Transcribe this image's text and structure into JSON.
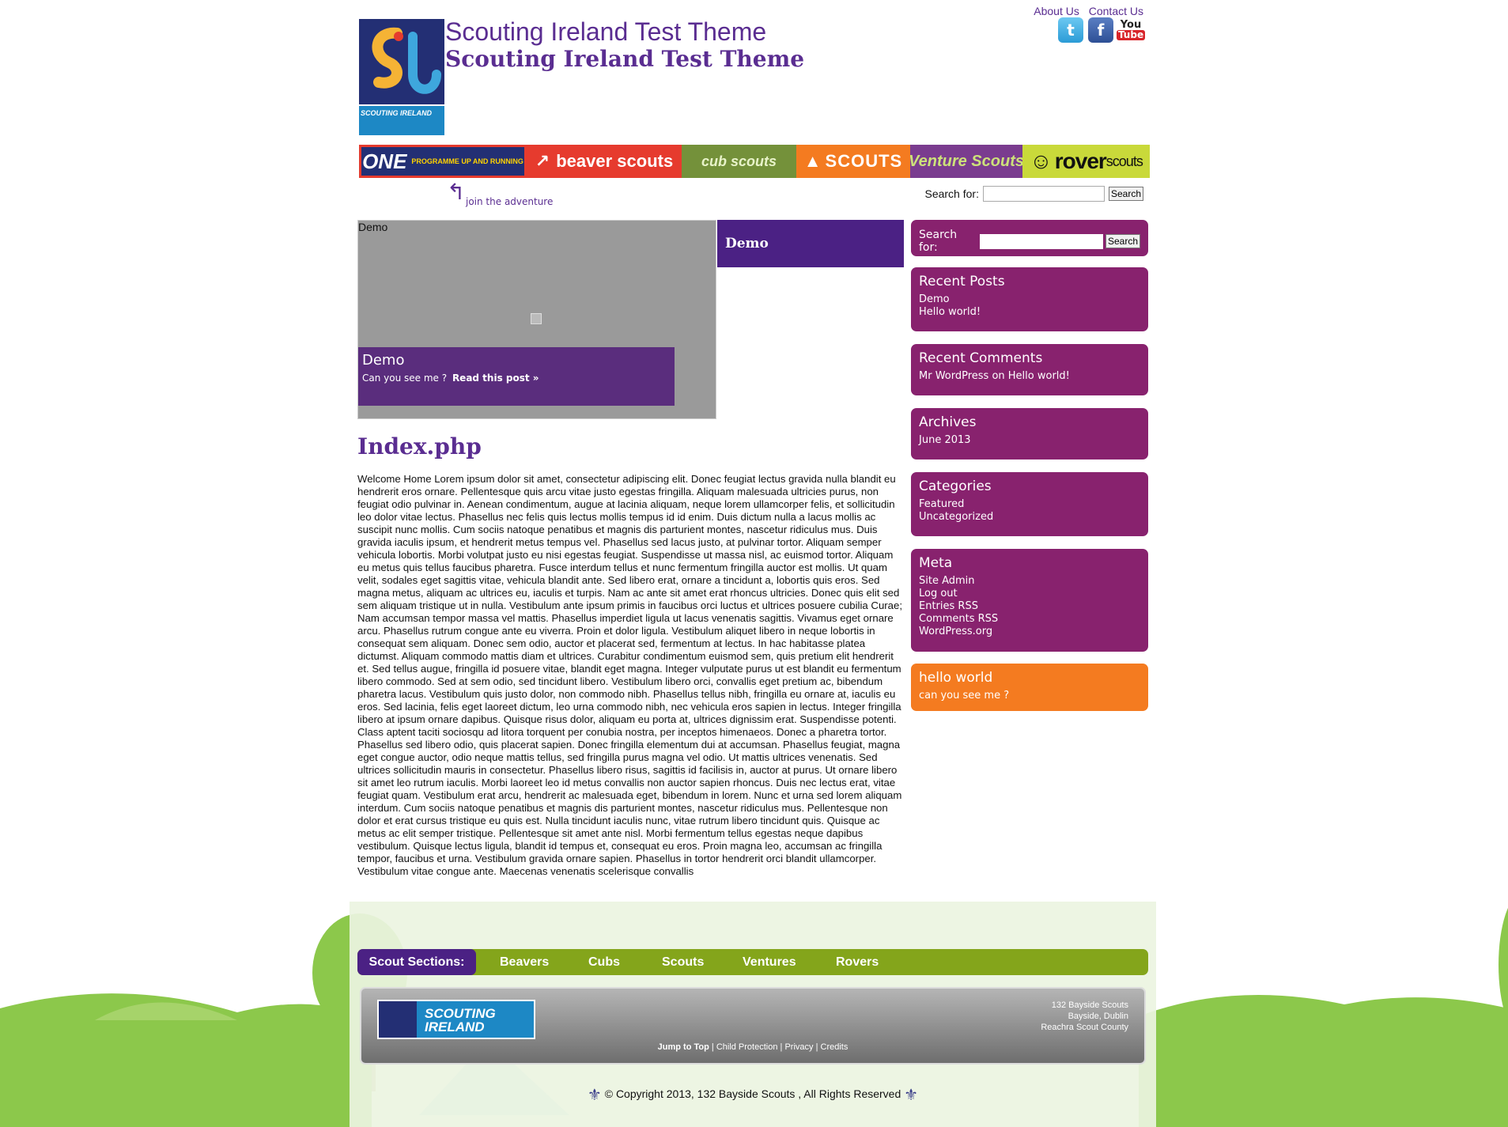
{
  "header": {
    "title": "Scouting Ireland Test Theme",
    "subtitle": "Scouting Ireland Test Theme",
    "logo_text": "SCOUTING IRELAND",
    "top_links": [
      "About Us",
      "Contact Us"
    ],
    "social": {
      "twitter": "t",
      "facebook": "f",
      "youtube_top": "You",
      "youtube_bottom": "Tube"
    }
  },
  "banner": {
    "one": "ONE",
    "one_sub": "PROGRAMME UP AND RUNNING",
    "beaver": "beaver scouts",
    "cub": "cub scouts",
    "scouts": "SCOUTS",
    "venture": "Venture Scouts",
    "rover": "rover",
    "rover_small": "scouts"
  },
  "tagline": "join the adventure",
  "search": {
    "label": "Search for:",
    "button": "Search",
    "value": ""
  },
  "slider": {
    "label": "Demo",
    "caption_title": "Demo",
    "caption_text": "Can you see me ?",
    "read_more": "Read this post »",
    "tab": "Demo"
  },
  "post": {
    "title": "Index.php",
    "body": "Welcome Home Lorem ipsum dolor sit amet, consectetur adipiscing elit. Donec feugiat lectus gravida nulla blandit eu hendrerit eros ornare. Pellentesque quis arcu vitae justo egestas fringilla. Aliquam malesuada ultricies purus, non feugiat odio pulvinar in. Aenean condimentum, augue at lacinia aliquam, neque lorem ullamcorper felis, et sollicitudin leo dolor vitae lectus. Phasellus nec felis quis lectus mollis tempus id id enim. Duis dictum nulla a lacus mollis ac suscipit nunc mollis. Cum sociis natoque penatibus et magnis dis parturient montes, nascetur ridiculus mus. Duis gravida iaculis ipsum, et hendrerit metus tempus vel. Phasellus sed lacus justo, at pulvinar tortor. Aliquam semper vehicula lobortis. Morbi volutpat justo eu nisi egestas feugiat. Suspendisse ut massa nisl, ac euismod tortor. Aliquam eu metus quis tellus faucibus pharetra. Fusce interdum tellus et nunc fermentum fringilla auctor est mollis. Ut quam velit, sodales eget sagittis vitae, vehicula blandit ante. Sed libero erat, ornare a tincidunt a, lobortis quis eros. Sed magna metus, aliquam ac ultrices eu, iaculis et turpis. Nam ac ante sit amet erat rhoncus ultricies. Donec quis elit sed sem aliquam tristique ut in nulla. Vestibulum ante ipsum primis in faucibus orci luctus et ultrices posuere cubilia Curae; Nam accumsan tempor massa vel mattis. Phasellus imperdiet ligula ut lacus venenatis sagittis. Vivamus eget ornare arcu. Phasellus rutrum congue ante eu viverra. Proin et dolor ligula. Vestibulum aliquet libero in neque lobortis in consequat sem aliquam. Donec sem odio, auctor et placerat sed, fermentum at lectus. In hac habitasse platea dictumst. Aliquam commodo mattis diam et ultrices. Curabitur condimentum euismod sem, quis pretium elit hendrerit et. Sed tellus augue, fringilla id posuere vitae, blandit eget magna. Integer vulputate purus ut est blandit eu fermentum libero commodo. Sed at sem odio, sed tincidunt libero. Vestibulum libero orci, convallis eget pretium ac, bibendum pharetra lacus. Vestibulum quis justo dolor, non commodo nibh. Phasellus tellus nibh, fringilla eu ornare at, iaculis eu eros. Sed lacinia, felis eget laoreet dictum, leo urna commodo nibh, nec vehicula eros sapien in lectus. Integer fringilla libero at ipsum ornare dapibus. Quisque risus dolor, aliquam eu porta at, ultrices dignissim erat. Suspendisse potenti. Class aptent taciti sociosqu ad litora torquent per conubia nostra, per inceptos himenaeos. Donec a pharetra tortor. Phasellus sed libero odio, quis placerat sapien. Donec fringilla elementum dui at accumsan. Phasellus feugiat, magna eget congue auctor, odio neque mattis tellus, sed fringilla purus magna vel odio. Ut mattis ultrices venenatis. Sed ultrices sollicitudin mauris in consectetur. Phasellus libero risus, sagittis id facilisis in, auctor at purus. Ut ornare libero sit amet leo rutrum iaculis. Morbi laoreet leo id metus convallis non auctor sapien rhoncus. Duis nec lectus erat, vitae feugiat quam. Vestibulum erat arcu, hendrerit ac malesuada eget, bibendum in lorem. Nunc et urna sed lorem aliquam interdum. Cum sociis natoque penatibus et magnis dis parturient montes, nascetur ridiculus mus. Pellentesque non dolor et erat cursus tristique eu quis est. Nulla tincidunt iaculis nunc, vitae rutrum libero tincidunt quis. Quisque ac metus ac elit semper tristique. Pellentesque sit amet ante nisl. Morbi fermentum tellus egestas neque dapibus vestibulum. Quisque lectus ligula, blandit id tempus et, consequat eu eros. Proin magna leo, accumsan ac fringilla tempor, faucibus et urna. Vestibulum gravida ornare sapien. Phasellus in tortor hendrerit orci blandit ullamcorper. Vestibulum vitae congue ante. Maecenas venenatis scelerisque convallis"
  },
  "sidebar": {
    "search": {
      "label": "Search for:",
      "button": "Search"
    },
    "recent_posts": {
      "title": "Recent Posts",
      "items": [
        "Demo",
        "Hello world!"
      ]
    },
    "recent_comments": {
      "title": "Recent Comments",
      "items": [
        "Mr WordPress on Hello world!"
      ]
    },
    "archives": {
      "title": "Archives",
      "items": [
        "June 2013"
      ]
    },
    "categories": {
      "title": "Categories",
      "items": [
        "Featured",
        "Uncategorized"
      ]
    },
    "meta": {
      "title": "Meta",
      "items": [
        "Site Admin",
        "Log out",
        "Entries RSS",
        "Comments RSS",
        "WordPress.org"
      ]
    },
    "hello": {
      "title": "hello world",
      "text": "can you see me ?"
    }
  },
  "sections_bar": {
    "label": "Scout Sections:",
    "items": [
      "Beavers",
      "Cubs",
      "Scouts",
      "Ventures",
      "Rovers"
    ]
  },
  "footer": {
    "logo_text": "SCOUTING IRELAND",
    "address": [
      "132 Bayside Scouts",
      "Bayside, Dublin",
      "Reachra Scout County"
    ],
    "links": [
      "Jump to Top",
      "Child Protection",
      "Privacy",
      "Credits"
    ],
    "copyright": "© Copyright 2013, 132 Bayside Scouts , All Rights Reserved"
  },
  "colors": {
    "brand_purple": "#5a2d91",
    "widget_purple": "#88226e",
    "widget_orange": "#f47b20",
    "section_green": "#84a51b",
    "section_purple": "#4b2184",
    "grass": "#8cc84b"
  },
  "icons": [
    "twitter-icon",
    "facebook-icon",
    "youtube-icon",
    "fleur-de-lis-icon",
    "curved-arrow-icon"
  ]
}
